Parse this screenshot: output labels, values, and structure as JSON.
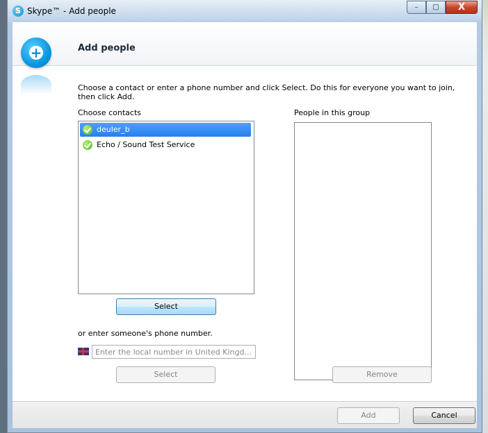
{
  "window": {
    "title": "Skype™ - Add people",
    "app_icon": "skype-icon",
    "minimize_label": "–",
    "maximize_label": "□",
    "close_label": "X"
  },
  "header": {
    "title": "Add people",
    "icon": "add-person-icon"
  },
  "instructions": "Choose a contact or enter a phone number and click Select. Do this for everyone you want to join, then click Add.",
  "contacts": {
    "label": "Choose contacts",
    "items": [
      {
        "name": "deuler_b",
        "selected": true,
        "status_icon": "online-status-icon"
      },
      {
        "name": "Echo / Sound Test Service",
        "selected": false,
        "status_icon": "online-status-icon"
      }
    ],
    "select_label": "Select"
  },
  "group": {
    "label": "People in this group",
    "remove_label": "Remove"
  },
  "phone": {
    "label": "or enter someone's phone number.",
    "placeholder": "Enter the local number in United Kingd...",
    "flag_icon": "uk-flag-icon",
    "select_label": "Select"
  },
  "footer": {
    "add_label": "Add",
    "cancel_label": "Cancel"
  },
  "colors": {
    "selection": "#2a7fe8",
    "skype_blue": "#0a96e0",
    "close_red": "#c9452a"
  }
}
